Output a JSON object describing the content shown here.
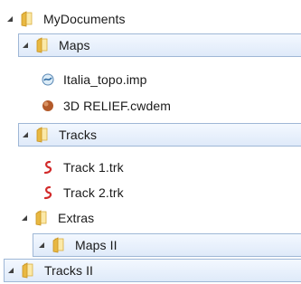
{
  "tree": {
    "root": {
      "label": "MyDocuments",
      "expanded": true
    },
    "maps": {
      "label": "Maps",
      "expanded": true,
      "selected": true
    },
    "italia": {
      "label": "Italia_topo.imp",
      "icon": "map-file-icon"
    },
    "relief": {
      "label": "3D RELIEF.cwdem",
      "icon": "relief-file-icon"
    },
    "tracks": {
      "label": "Tracks",
      "expanded": true,
      "selected": true
    },
    "track1": {
      "label": "Track 1.trk",
      "icon": "track-file-icon"
    },
    "track2": {
      "label": "Track 2.trk",
      "icon": "track-file-icon"
    },
    "extras": {
      "label": "Extras",
      "expanded": true
    },
    "maps2": {
      "label": "Maps II",
      "expanded": true,
      "selected": true
    },
    "tracks2": {
      "label": "Tracks II",
      "expanded": true,
      "selected": true
    }
  },
  "colors": {
    "folder": "#e8b842",
    "folder_dark": "#c9931f",
    "selection_border": "#9fb7d6",
    "track_red": "#d22a2a"
  }
}
